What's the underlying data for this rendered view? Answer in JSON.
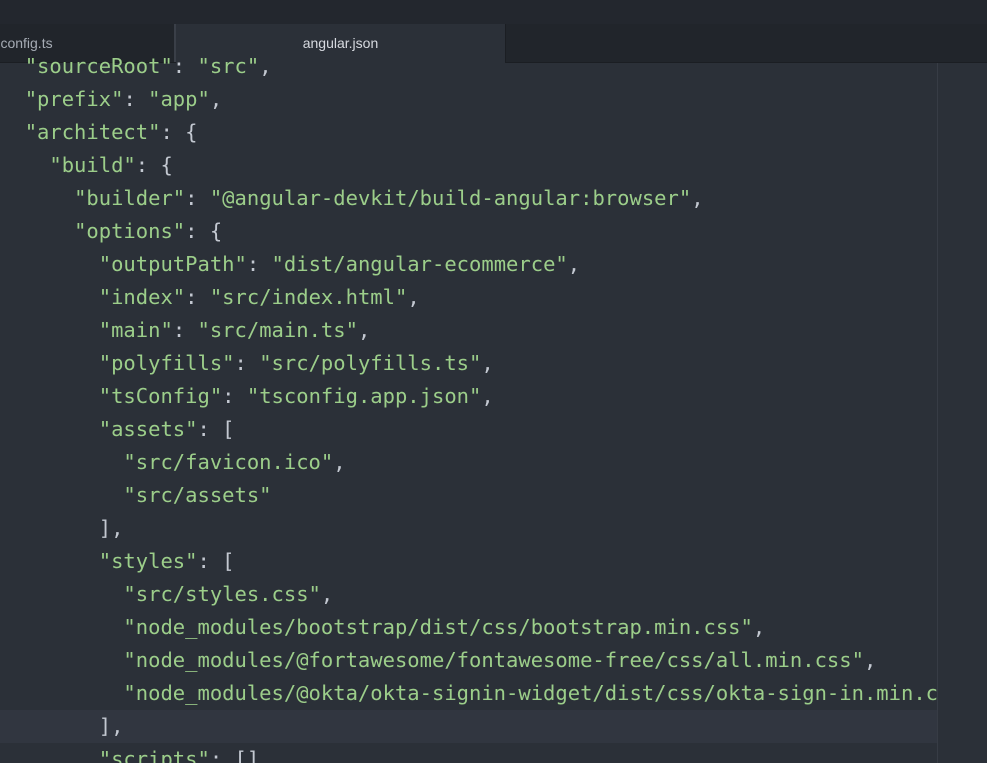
{
  "tabs": [
    {
      "label": "app-config.ts",
      "visible_label": "p-config.ts",
      "active": false
    },
    {
      "label": "angular.json",
      "active": true
    }
  ],
  "code_lines": [
    {
      "indent": "  ",
      "key": "\"sourceRoot\"",
      "rest": ": \"src\","
    },
    {
      "indent": "  ",
      "key": "\"prefix\"",
      "rest": ": \"app\","
    },
    {
      "indent": "  ",
      "key": "\"architect\"",
      "rest": ": {"
    },
    {
      "indent": "    ",
      "key": "\"build\"",
      "rest": ": {"
    },
    {
      "indent": "      ",
      "key": "\"builder\"",
      "rest": ": \"@angular-devkit/build-angular:browser\","
    },
    {
      "indent": "      ",
      "key": "\"options\"",
      "rest": ": {"
    },
    {
      "indent": "        ",
      "key": "\"outputPath\"",
      "rest": ": \"dist/angular-ecommerce\","
    },
    {
      "indent": "        ",
      "key": "\"index\"",
      "rest": ": \"src/index.html\","
    },
    {
      "indent": "        ",
      "key": "\"main\"",
      "rest": ": \"src/main.ts\","
    },
    {
      "indent": "        ",
      "key": "\"polyfills\"",
      "rest": ": \"src/polyfills.ts\","
    },
    {
      "indent": "        ",
      "key": "\"tsConfig\"",
      "rest": ": \"tsconfig.app.json\","
    },
    {
      "indent": "        ",
      "key": "\"assets\"",
      "rest": ": ["
    },
    {
      "indent": "          ",
      "key": "\"src/favicon.ico\"",
      "rest": ","
    },
    {
      "indent": "          ",
      "key": "\"src/assets\"",
      "rest": ""
    },
    {
      "indent": "        ",
      "key": "",
      "rest": "],"
    },
    {
      "indent": "        ",
      "key": "\"styles\"",
      "rest": ": ["
    },
    {
      "indent": "          ",
      "key": "\"src/styles.css\"",
      "rest": ","
    },
    {
      "indent": "          ",
      "key": "\"node_modules/bootstrap/dist/css/bootstrap.min.css\"",
      "rest": ","
    },
    {
      "indent": "          ",
      "key": "\"node_modules/@fortawesome/fontawesome-free/css/all.min.css\"",
      "rest": ","
    },
    {
      "indent": "          ",
      "key": "\"node_modules/@okta/okta-signin-widget/dist/css/okta-sign-in.min.css\"",
      "rest": ""
    },
    {
      "indent": "        ",
      "key": "",
      "rest": "],"
    },
    {
      "indent": "        ",
      "key": "\"scripts\"",
      "rest": ": []"
    }
  ],
  "current_line_index": 20,
  "colors": {
    "background": "#2b3038",
    "tab_bar": "#21252b",
    "string": "#9cce8a",
    "punctuation": "#c3c8d1"
  }
}
